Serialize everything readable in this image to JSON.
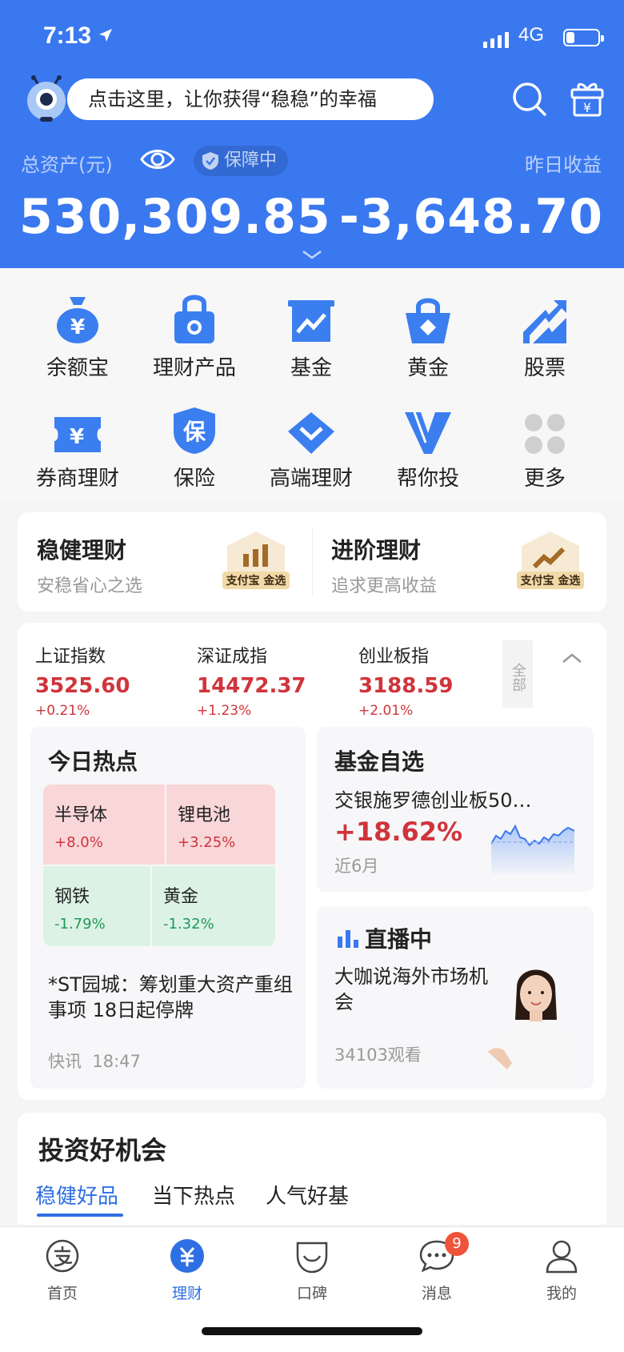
{
  "status_bar": {
    "time": "7:13",
    "network": "4G",
    "battery_level": 0.25
  },
  "header": {
    "search_prompt": "点击这里，让你获得“稳稳”的幸福",
    "total_assets_label": "总资产(元)",
    "protection_badge": "保障中",
    "total_assets_value": "530,309.85",
    "yesterday_label": "昨日收益",
    "yesterday_value": "-3,648.70"
  },
  "grid": [
    {
      "label": "余额宝",
      "icon": "money-bag-icon"
    },
    {
      "label": "理财产品",
      "icon": "lock-bag-icon"
    },
    {
      "label": "基金",
      "icon": "chart-board-icon"
    },
    {
      "label": "黄金",
      "icon": "gold-basket-icon"
    },
    {
      "label": "股票",
      "icon": "stock-trend-icon"
    },
    {
      "label": "券商理财",
      "icon": "yuan-ticket-icon"
    },
    {
      "label": "保险",
      "icon": "insurance-shield-icon"
    },
    {
      "label": "高端理财",
      "icon": "diamond-icon"
    },
    {
      "label": "帮你投",
      "icon": "v-logo-icon"
    },
    {
      "label": "更多",
      "icon": "more-dots-icon"
    }
  ],
  "picks": [
    {
      "title": "稳健理财",
      "subtitle": "安稳省心之选",
      "badge": "支付宝 金选"
    },
    {
      "title": "进阶理财",
      "subtitle": "追求更高收益",
      "badge": "支付宝 金选"
    }
  ],
  "indices": [
    {
      "name": "上证指数",
      "value": "3525.60",
      "change": "+0.21%"
    },
    {
      "name": "深证成指",
      "value": "14472.37",
      "change": "+1.23%"
    },
    {
      "name": "创业板指",
      "value": "3188.59",
      "change": "+2.01%"
    }
  ],
  "all_label": "全部",
  "hot": {
    "title": "今日热点",
    "tiles": [
      {
        "name": "半导体",
        "change": "+8.0%"
      },
      {
        "name": "锂电池",
        "change": "+3.25%"
      },
      {
        "name": "钢铁",
        "change": "-1.79%"
      },
      {
        "name": "黄金",
        "change": "-1.32%"
      }
    ],
    "news": "*ST园城：筹划重大资产重组事项 18日起停牌",
    "source": "快讯",
    "time": "18:47"
  },
  "fund": {
    "title": "基金自选",
    "name": "交银施罗德创业板50…",
    "return": "+18.62%",
    "period": "近6月"
  },
  "live": {
    "title": "直播中",
    "desc": "大咖说海外市场机会",
    "views": "34103观看"
  },
  "opportunity": {
    "title": "投资好机会",
    "tabs": [
      "稳健好品",
      "当下热点",
      "人气好基"
    ]
  },
  "tabbar": [
    {
      "label": "首页",
      "icon": "alipay-home-icon"
    },
    {
      "label": "理财",
      "icon": "yuan-circle-icon"
    },
    {
      "label": "口碑",
      "icon": "koubei-icon"
    },
    {
      "label": "消息",
      "icon": "chat-bubble-icon",
      "badge": "9"
    },
    {
      "label": "我的",
      "icon": "person-icon"
    }
  ],
  "colors": {
    "brand_blue": "#3a78f0",
    "up_red": "#d0343b",
    "down_green": "#1e9a5a"
  }
}
